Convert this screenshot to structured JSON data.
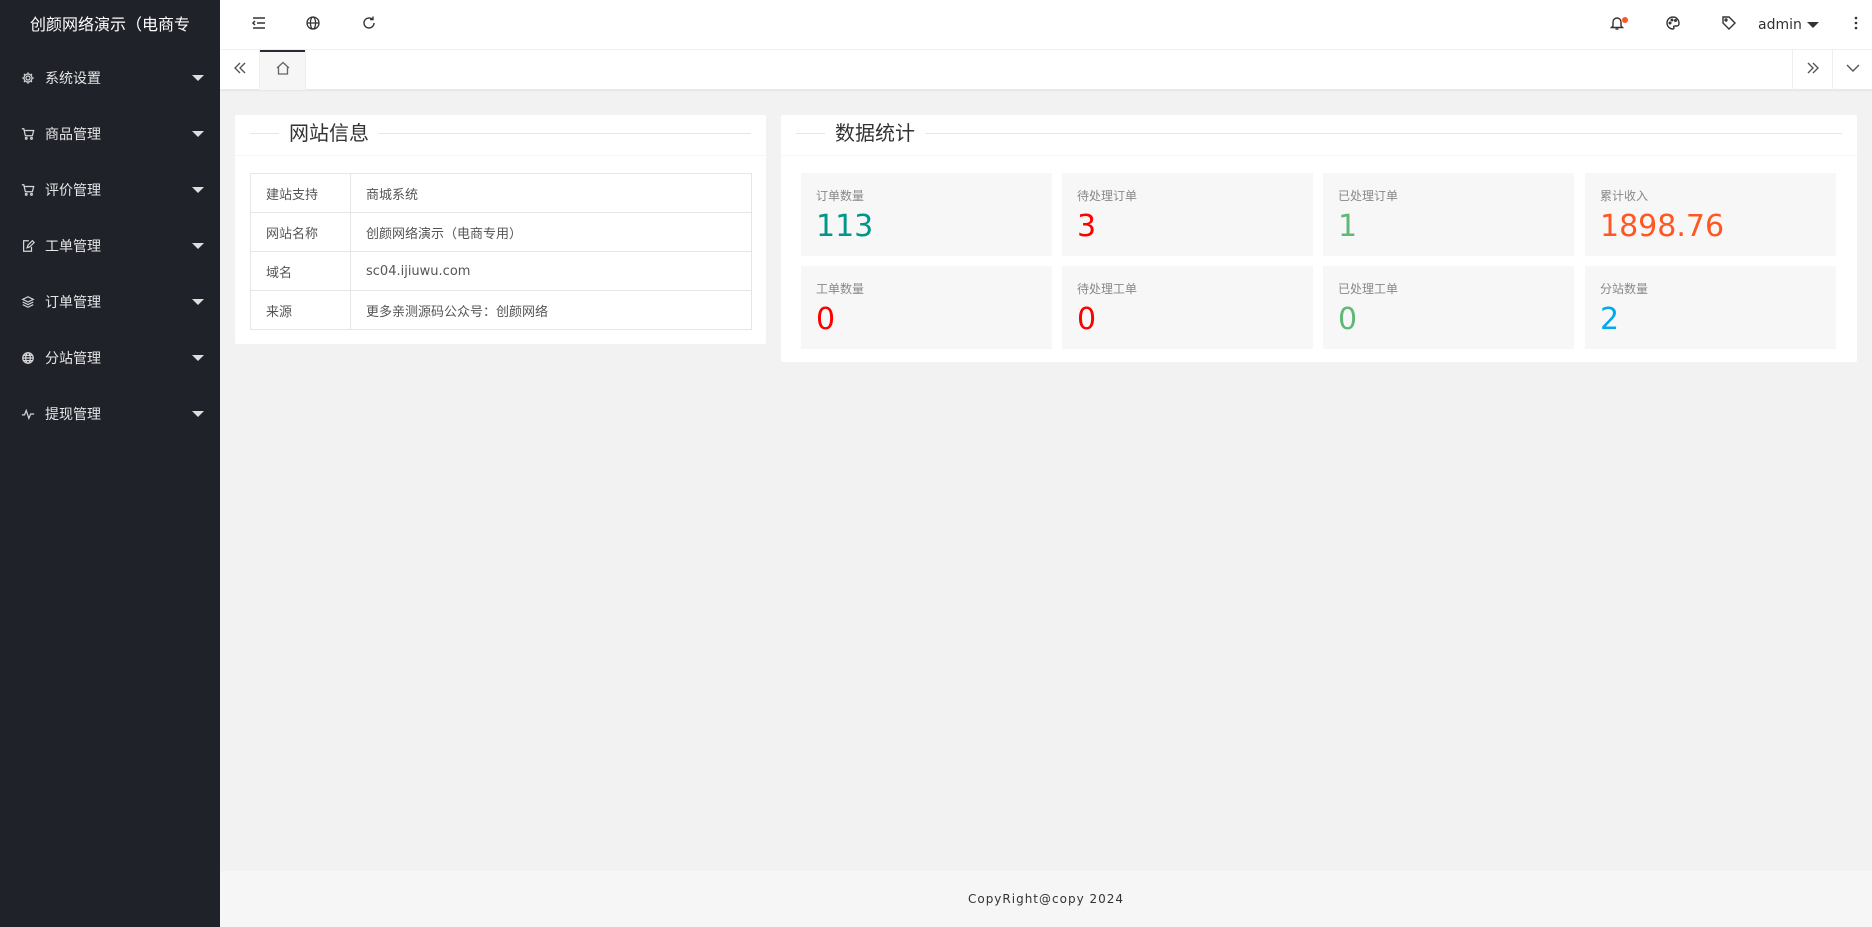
{
  "sidebar": {
    "logo": "创颜网络演示（电商专",
    "items": [
      {
        "label": "系统设置",
        "icon": "gear-icon"
      },
      {
        "label": "商品管理",
        "icon": "cart-icon"
      },
      {
        "label": "评价管理",
        "icon": "cart-icon"
      },
      {
        "label": "工单管理",
        "icon": "edit-icon"
      },
      {
        "label": "订单管理",
        "icon": "layers-icon"
      },
      {
        "label": "分站管理",
        "icon": "globe-icon"
      },
      {
        "label": "提现管理",
        "icon": "pulse-icon"
      }
    ]
  },
  "header": {
    "menu_toggle_icon": "menu-fold-icon",
    "website_icon": "globe-icon",
    "refresh_icon": "refresh-icon",
    "notice_icon": "bell-icon",
    "theme_icon": "palette-icon",
    "tag_icon": "tag-icon",
    "user": "admin",
    "more_icon": "more-vertical-icon"
  },
  "tabs": {
    "home_icon": "home-icon"
  },
  "site_info": {
    "title": "网站信息",
    "rows": [
      {
        "key": "建站支持",
        "value": "商城系统"
      },
      {
        "key": "网站名称",
        "value": "创颜网络演示（电商专用）"
      },
      {
        "key": "域名",
        "value": "sc04.ijiuwu.com"
      },
      {
        "key": "来源",
        "value": "更多亲测源码公众号：创颜网络"
      }
    ]
  },
  "stats": {
    "title": "数据统计",
    "items": [
      {
        "label": "订单数量",
        "value": "113",
        "color": "#009688"
      },
      {
        "label": "待处理订单",
        "value": "3",
        "color": "#ff0000"
      },
      {
        "label": "已处理订单",
        "value": "1",
        "color": "#5fb878"
      },
      {
        "label": "累计收入",
        "value": "1898.76",
        "color": "#ff5722"
      },
      {
        "label": "工单数量",
        "value": "0",
        "color": "#ff0000"
      },
      {
        "label": "待处理工单",
        "value": "0",
        "color": "#ff0000"
      },
      {
        "label": "已处理工单",
        "value": "0",
        "color": "#5fb878"
      },
      {
        "label": "分站数量",
        "value": "2",
        "color": "#01aaed"
      }
    ]
  },
  "footer": {
    "text": "CopyRight@copy 2024"
  }
}
